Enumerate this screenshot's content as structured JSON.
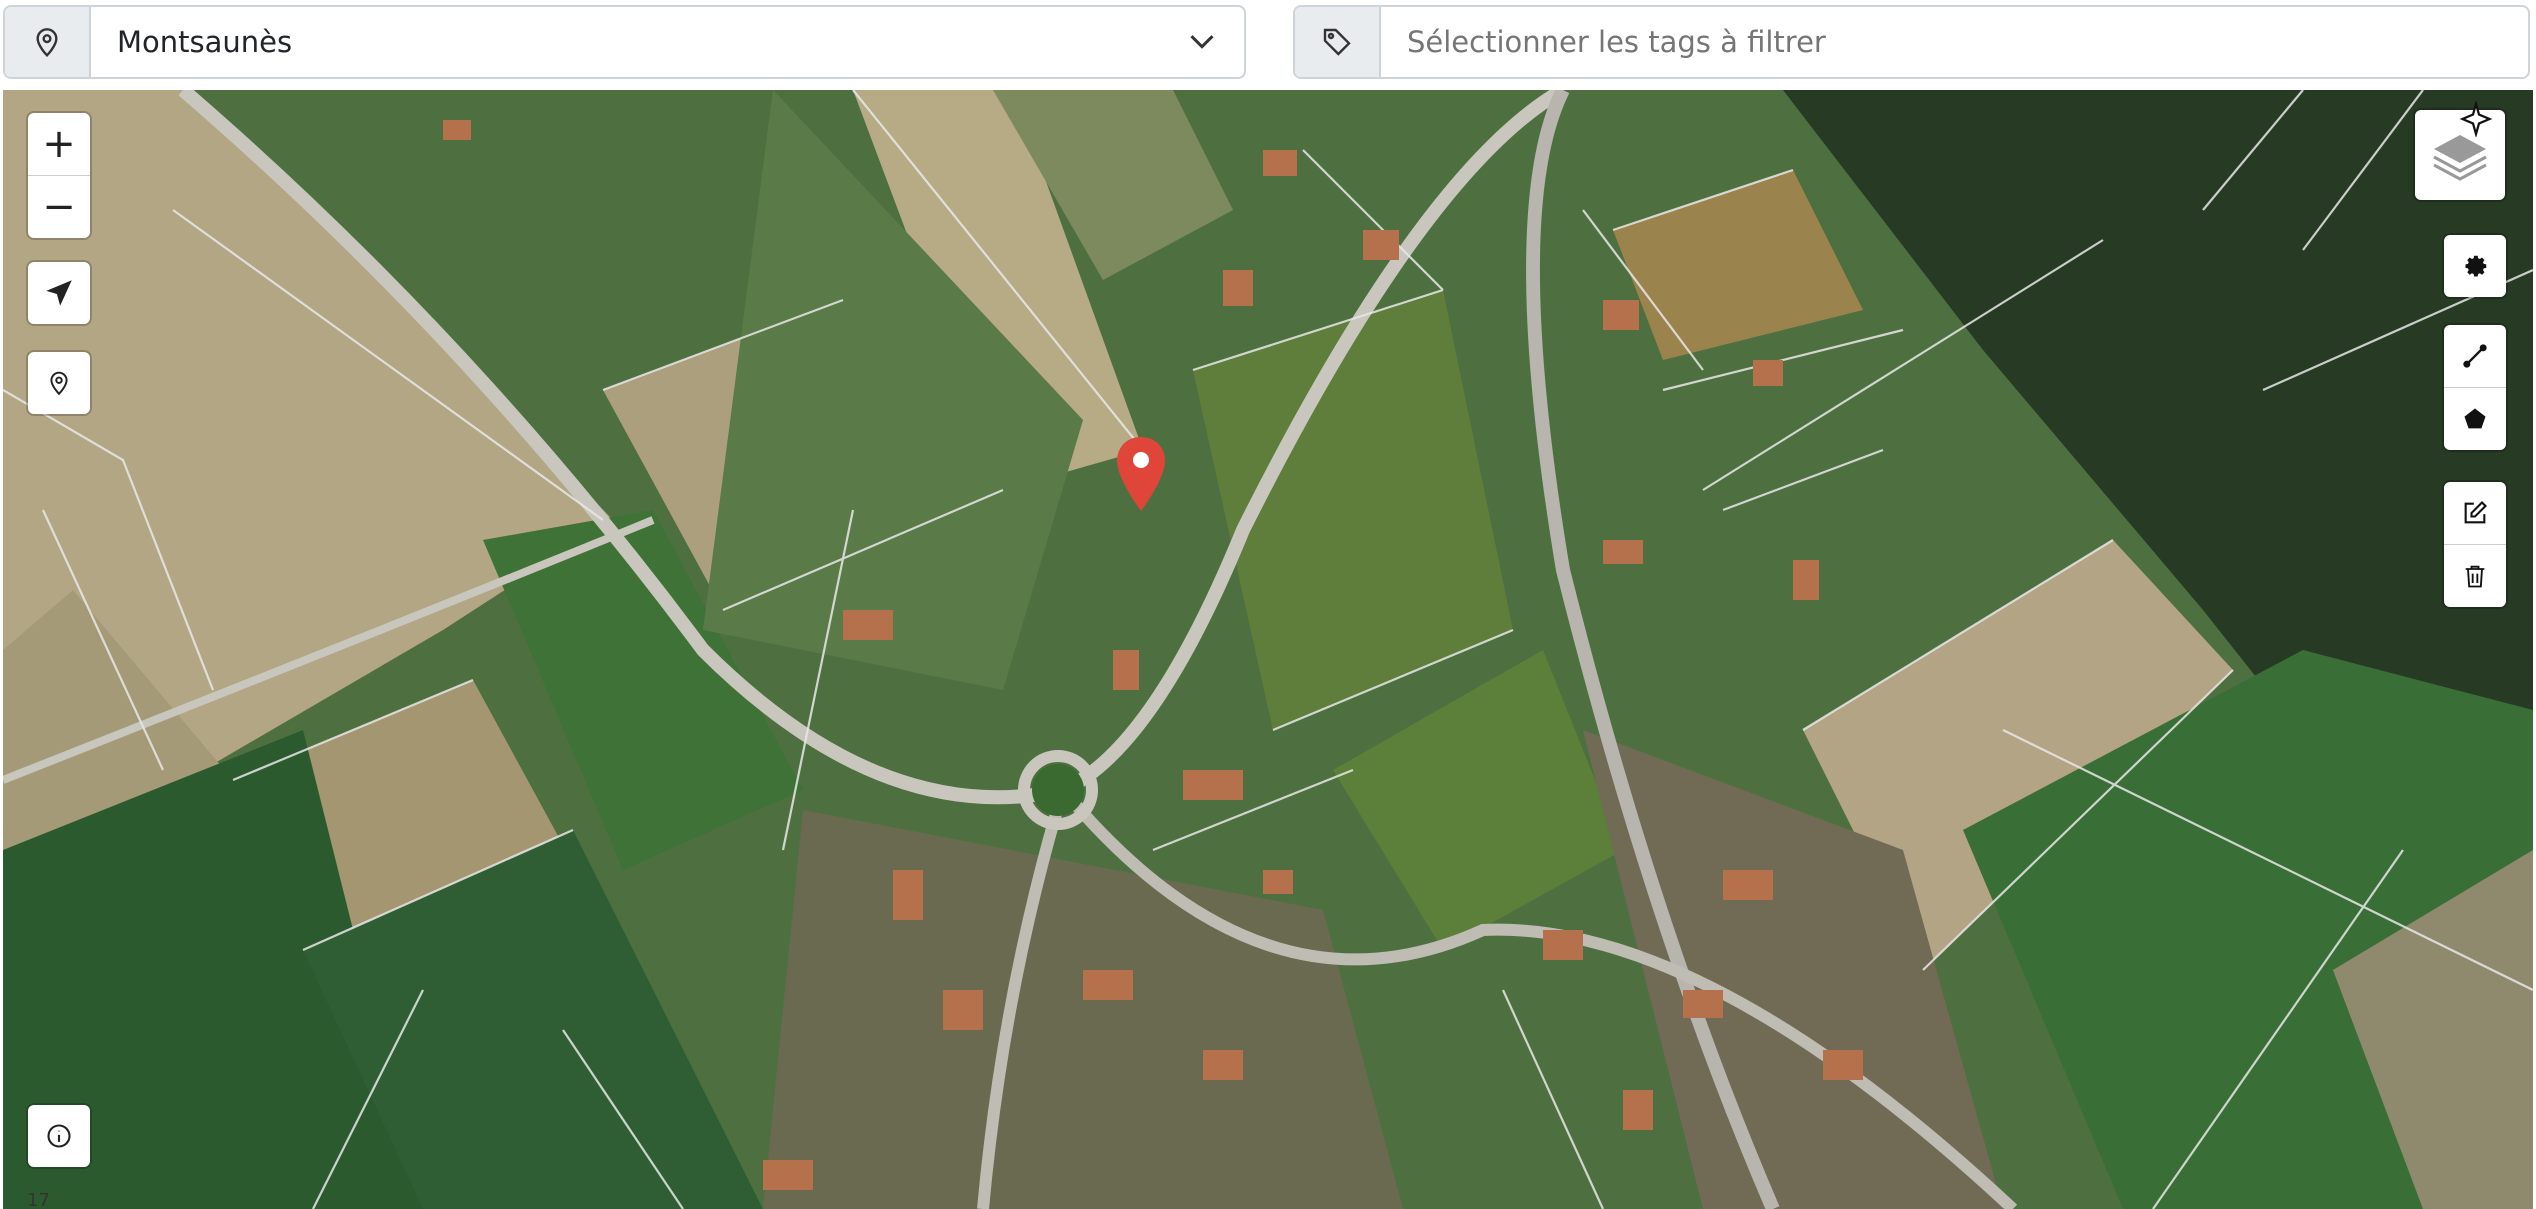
{
  "location_select": {
    "icon": "map-pin-icon",
    "value": "Montsaunès",
    "caret_icon": "chevron-down-icon"
  },
  "tag_filter": {
    "icon": "tag-icon",
    "placeholder": "Sélectionner les tags à filtrer"
  },
  "map": {
    "zoom_level": "17",
    "left_controls": {
      "zoom_in": "+",
      "zoom_out": "−",
      "locate_icon": "navigation-arrow-icon",
      "pin_icon": "map-pin-icon",
      "info_icon": "info-icon"
    },
    "right_controls": {
      "layers_icon": "layers-icon",
      "sparkle_icon": "sparkle-icon",
      "settings_icon": "gear-icon",
      "line_icon": "draw-line-icon",
      "polygon_icon": "draw-polygon-icon",
      "edit_icon": "edit-icon",
      "delete_icon": "trash-icon"
    },
    "marker": {
      "color": "#e0453a"
    }
  }
}
